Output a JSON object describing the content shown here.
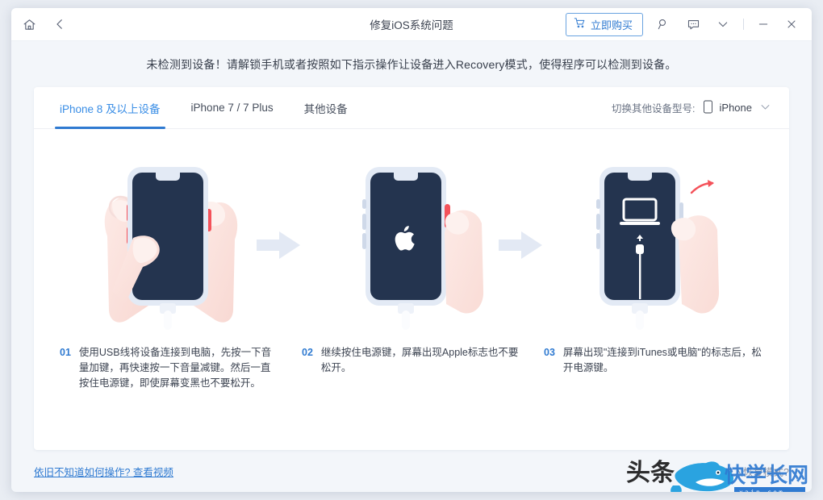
{
  "titlebar": {
    "home_icon": "home-icon",
    "back_icon": "back-arrow-icon",
    "title": "修复iOS系统问题",
    "buy_label": "立即购买",
    "cart_icon": "cart-icon",
    "search_icon": "search-icon",
    "feedback_icon": "feedback-icon",
    "chevron_icon": "chevron-down-icon",
    "minimize_label": "—",
    "close_label": "✕"
  },
  "banner": {
    "message": "未检测到设备！请解锁手机或者按照如下指示操作让设备进入Recovery模式，使得程序可以检测到设备。"
  },
  "tabs": [
    {
      "label": "iPhone 8 及以上设备",
      "active": true
    },
    {
      "label": "iPhone 7 / 7 Plus",
      "active": false
    },
    {
      "label": "其他设备",
      "active": false
    }
  ],
  "device_switch": {
    "label": "切换其他设备型号:",
    "phone_icon": "phone-icon",
    "selected": "iPhone",
    "chevron_icon": "chevron-down-icon"
  },
  "steps": [
    {
      "number": "01",
      "text": "使用USB线将设备连接到电脑，先按一下音量加键，再快速按一下音量减键。然后一直按住电源键，即使屏幕变黑也不要松开。",
      "illustration": "phone-two-hands-dark-screen"
    },
    {
      "number": "02",
      "text": "继续按住电源键，屏幕出现Apple标志也不要松开。",
      "illustration": "phone-apple-logo-hand-power-button"
    },
    {
      "number": "03",
      "text": "屏幕出现\"连接到iTunes或电脑\"的标志后，松开电源键。",
      "illustration": "phone-connect-to-itunes-hand-release"
    }
  ],
  "footer": {
    "help_link": "依旧不知道如何操作? 查看视频",
    "recovery_note": "无法进入恢复模式?"
  },
  "watermark": {
    "text_left": "头条",
    "text_right": "快学长网",
    "domain": "xajn.com",
    "logo": "shark-logo"
  },
  "colors": {
    "accent": "#2f7ad1",
    "tab_active": "#3a8ee6",
    "phone_screen": "#24344f",
    "phone_body": "#e3eaf5",
    "button_red": "#f4525a",
    "arrow": "#e3e9f4",
    "card_bg": "#ffffff",
    "app_bg": "#f3f6fa"
  }
}
